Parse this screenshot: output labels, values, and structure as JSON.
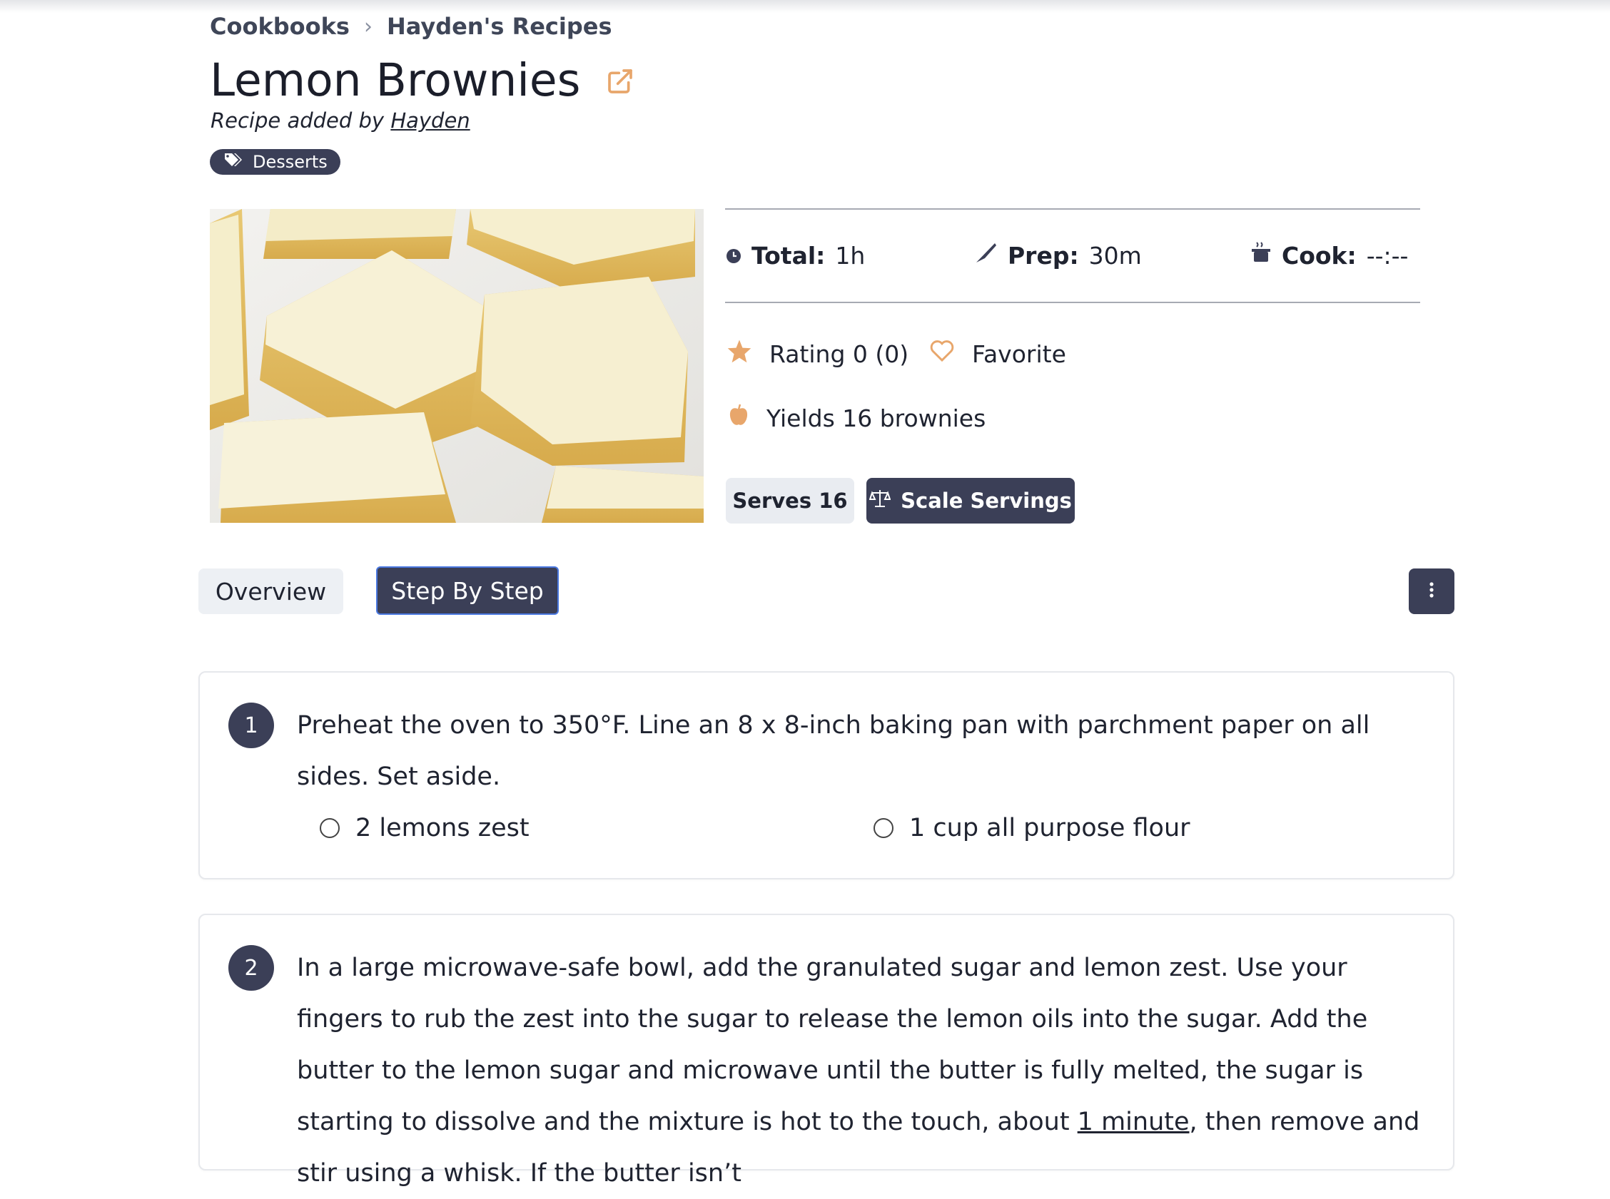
{
  "breadcrumb": {
    "cookbooks": "Cookbooks",
    "separator": "›",
    "current": "Hayden's Recipes"
  },
  "recipe": {
    "title": "Lemon Brownies",
    "added_by_prefix": "Recipe added by",
    "added_by_user": "Hayden",
    "tag": "Desserts"
  },
  "times": {
    "total_label": "Total:",
    "total_value": "1h",
    "prep_label": "Prep:",
    "prep_value": "30m",
    "cook_label": "Cook:",
    "cook_value": "--:--"
  },
  "meta": {
    "rating": "Rating 0 (0)",
    "favorite": "Favorite",
    "yields": "Yields 16 brownies",
    "serves": "Serves 16",
    "scale": "Scale Servings"
  },
  "tabs": {
    "overview": "Overview",
    "step_by_step": "Step By Step"
  },
  "steps": [
    {
      "number": "1",
      "text": "Preheat the oven to 350°F. Line an 8 x 8-inch baking pan with parchment paper on all sides. Set aside.",
      "ingredients": [
        "2 lemons zest",
        "1 cup all purpose flour"
      ]
    },
    {
      "number": "2",
      "text_before": "In a large microwave-safe bowl, add the granulated sugar and lemon zest. Use your fingers to rub the zest into the sugar to release the lemon oils into the sugar. Add the butter to the lemon sugar and microwave until the butter is fully melted, the sugar is starting to dissolve and the mixture is hot to the touch, about ",
      "timer": "1 minute",
      "text_after": ", then remove and stir using a whisk. If the butter isn’t"
    }
  ],
  "colors": {
    "accent": "#e8a66b",
    "dark": "#3b3f57",
    "light_button": "#e9ecf1"
  }
}
